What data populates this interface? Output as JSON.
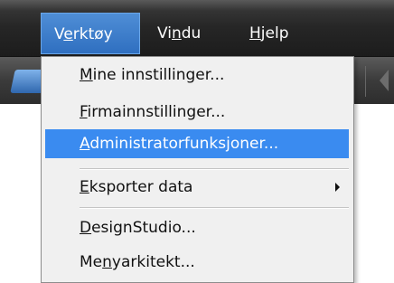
{
  "menubar": {
    "items": [
      {
        "label_pre": "V",
        "label_u": "e",
        "label_post": "rktøy"
      },
      {
        "label_pre": "Vi",
        "label_u": "n",
        "label_post": "du"
      },
      {
        "label_pre": "",
        "label_u": "H",
        "label_post": "jelp"
      }
    ],
    "active_index": 0
  },
  "dropdown": {
    "items": [
      {
        "pre": "",
        "u": "M",
        "post": "ine innstillinger...",
        "selected": false,
        "submenu": false
      },
      {
        "pre": "",
        "u": "F",
        "post": "irmainnstillinger...",
        "selected": false,
        "submenu": false
      },
      {
        "pre": "",
        "u": "A",
        "post": "dministratorfunksjoner...",
        "selected": true,
        "submenu": false
      },
      {
        "pre": "",
        "u": "E",
        "post": "ksporter data",
        "selected": false,
        "submenu": true
      },
      {
        "pre": "",
        "u": "D",
        "post": "esignStudio...",
        "selected": false,
        "submenu": false
      },
      {
        "pre": "Me",
        "u": "n",
        "post": "yarkitekt...",
        "selected": false,
        "submenu": false
      }
    ]
  },
  "colors": {
    "menubar_bg": "#262626",
    "active_menu": "#3a7fd0",
    "selected_item": "#3a8bf0",
    "dropdown_bg": "#f0f0f0"
  }
}
